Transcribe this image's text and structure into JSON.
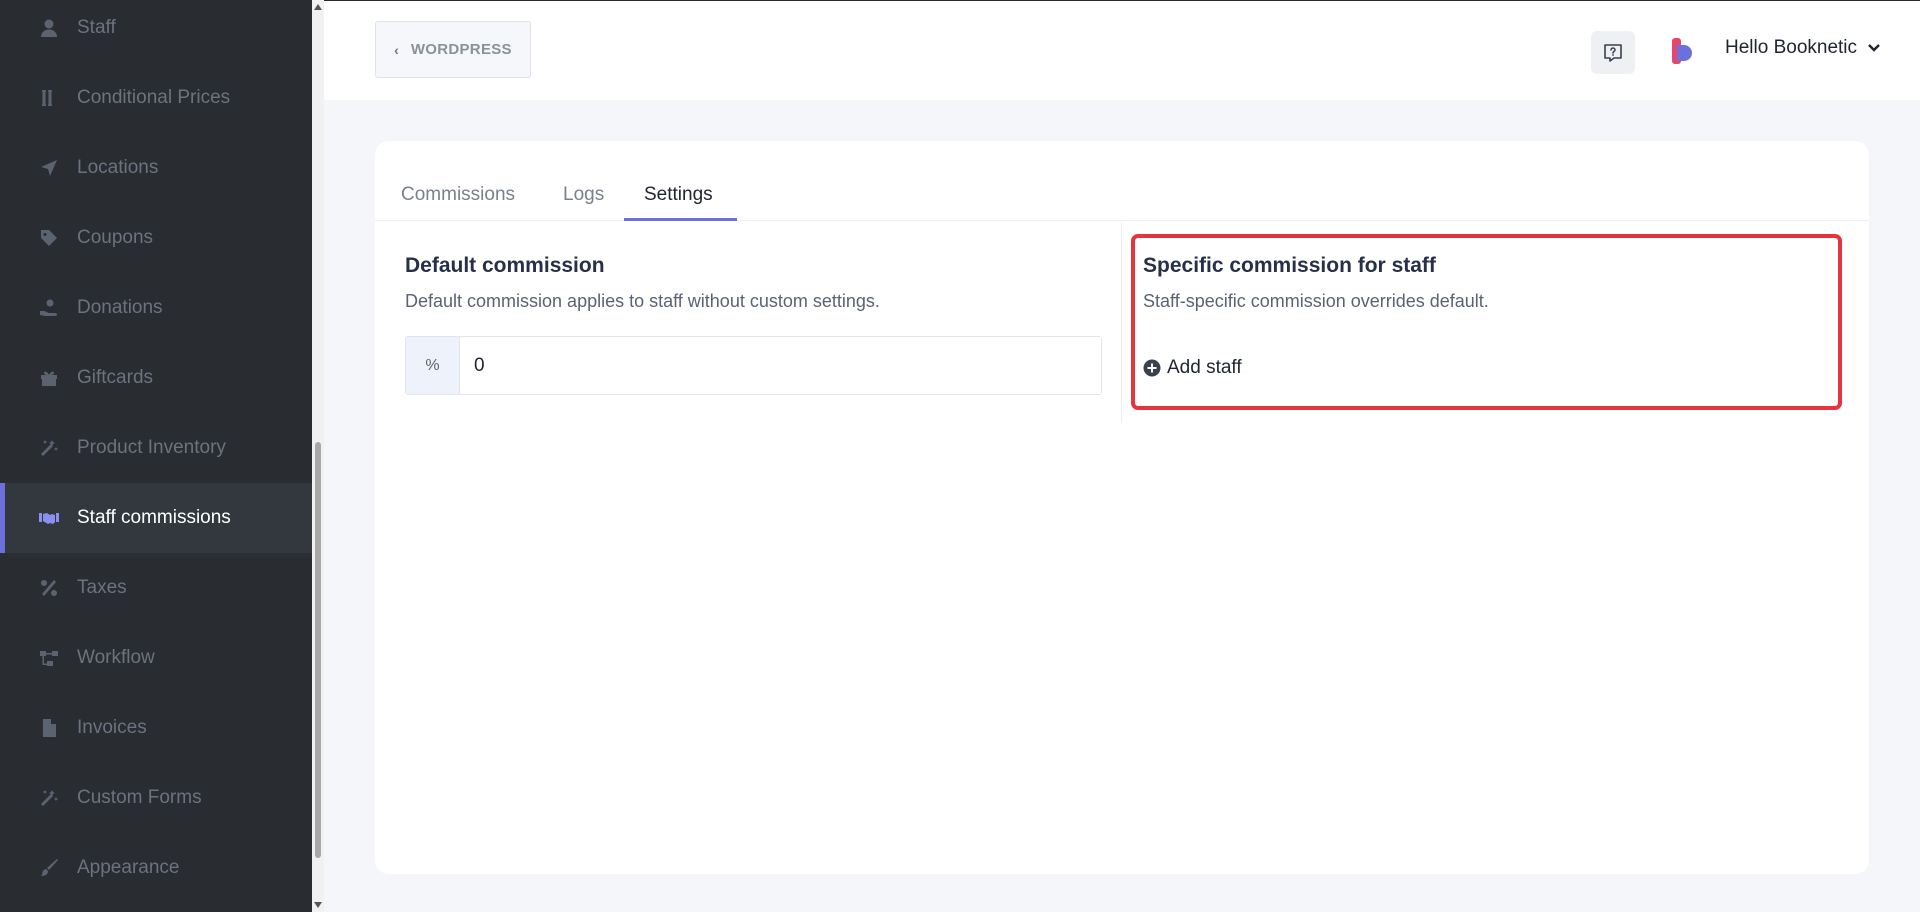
{
  "sidebar": {
    "items": [
      {
        "label": "Staff",
        "icon": "user-icon",
        "active": false
      },
      {
        "label": "Conditional Prices",
        "icon": "text-cursor-icon",
        "active": false
      },
      {
        "label": "Locations",
        "icon": "location-arrow-icon",
        "active": false
      },
      {
        "label": "Coupons",
        "icon": "tag-icon",
        "active": false
      },
      {
        "label": "Donations",
        "icon": "donate-hand-icon",
        "active": false
      },
      {
        "label": "Giftcards",
        "icon": "gift-icon",
        "active": false
      },
      {
        "label": "Product Inventory",
        "icon": "magic-wand-icon",
        "active": false
      },
      {
        "label": "Staff commissions",
        "icon": "handshake-icon",
        "active": true
      },
      {
        "label": "Taxes",
        "icon": "percent-icon",
        "active": false
      },
      {
        "label": "Workflow",
        "icon": "workflow-icon",
        "active": false
      },
      {
        "label": "Invoices",
        "icon": "file-icon",
        "active": false
      },
      {
        "label": "Custom Forms",
        "icon": "magic-wand-icon",
        "active": false
      },
      {
        "label": "Appearance",
        "icon": "paint-brush-icon",
        "active": false
      }
    ]
  },
  "header": {
    "back_label": "WORDPRESS",
    "user_greeting": "Hello Booknetic"
  },
  "tabs": [
    {
      "label": "Commissions",
      "active": false
    },
    {
      "label": "Logs",
      "active": false
    },
    {
      "label": "Settings",
      "active": true
    }
  ],
  "default_commission": {
    "title": "Default commission",
    "description": "Default commission applies to staff without custom settings.",
    "prefix": "%",
    "value": "0"
  },
  "specific_commission": {
    "title": "Specific commission for staff",
    "description": "Staff-specific commission overrides default.",
    "add_label": "Add staff"
  },
  "colors": {
    "accent": "#6c70dc",
    "highlight": "#e5343d",
    "sidebar_bg": "#292d32"
  }
}
